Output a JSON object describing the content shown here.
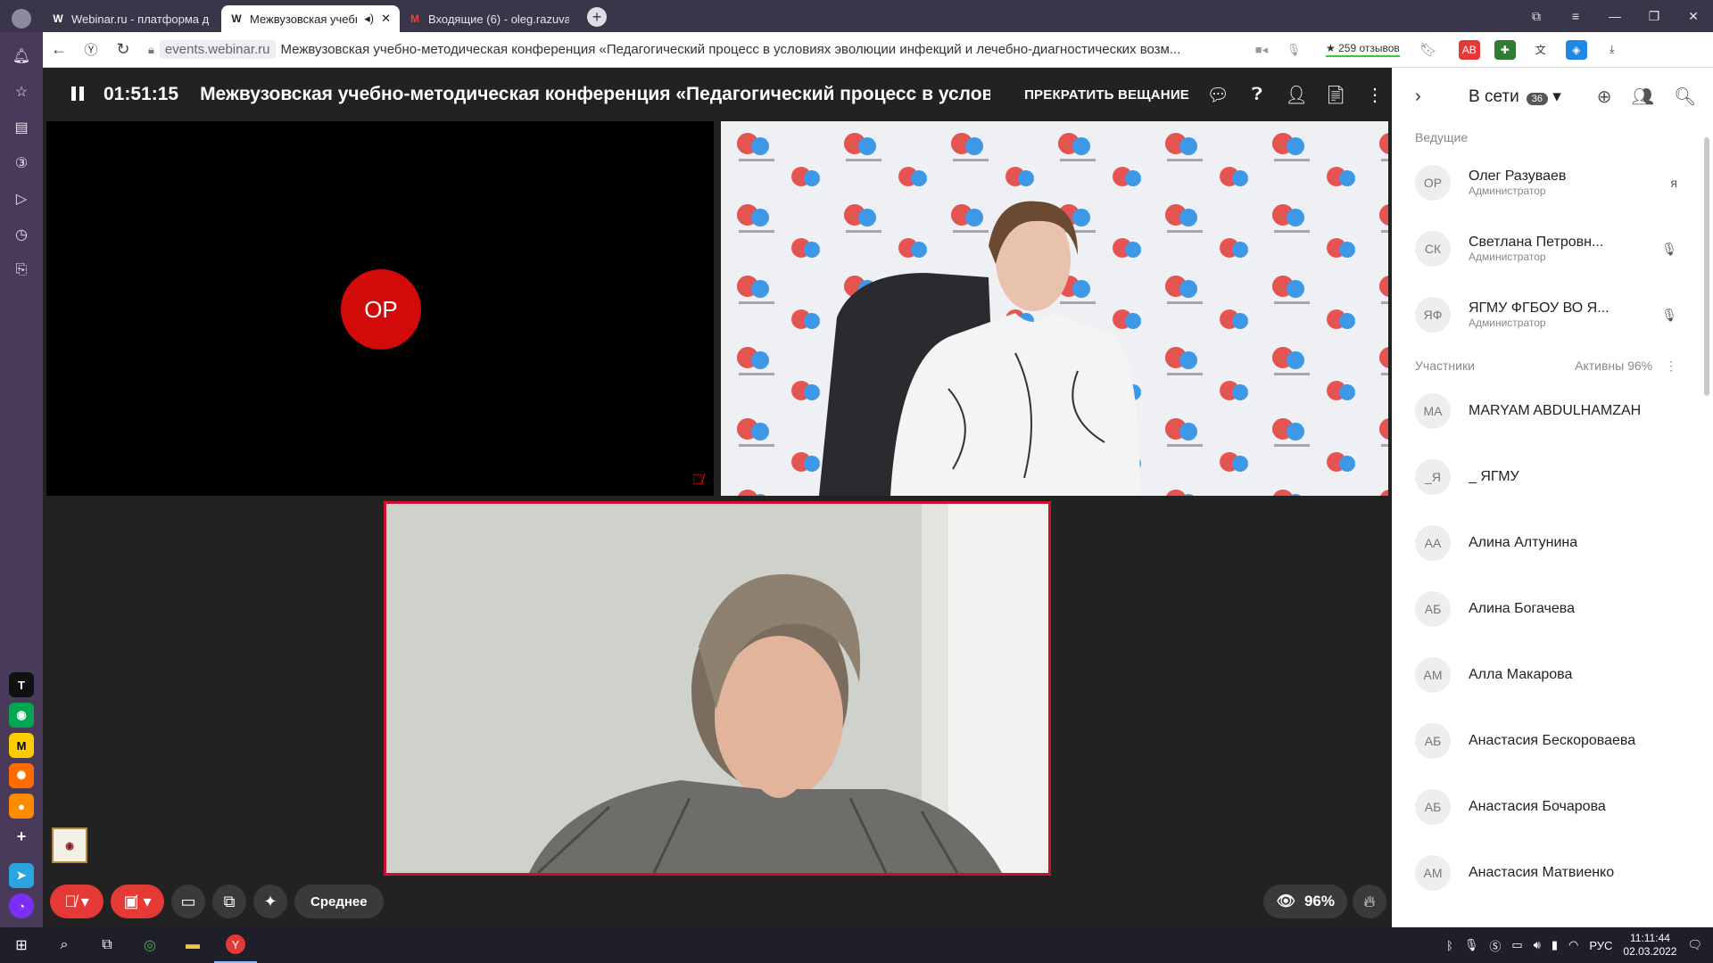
{
  "browser": {
    "tabs": [
      {
        "favicon": "W",
        "label": "Webinar.ru - платформа д"
      },
      {
        "favicon": "W",
        "label": "Межвузовская учебн",
        "active": true
      },
      {
        "favicon": "M",
        "label": "Входящие (6) - oleg.razuva"
      }
    ],
    "new_tab": "+",
    "address": {
      "domain": "events.webinar.ru",
      "page_title": "Межвузовская учебно-методическая конференция «Педагогический процесс в условиях эволюции инфекций и лечебно-диагностических возм..."
    },
    "reviews": "★ 259 отзывов"
  },
  "webinar": {
    "timer": "01:51:15",
    "title": "Межвузовская учебно-методическая конференция «Педагогический процесс в условиях эв",
    "stop_broadcast": "ПРЕКРАТИТЬ ВЕЩАНИЕ",
    "video1_initials": "ОР",
    "quality": "Среднее",
    "viewers_percent": "96%"
  },
  "panel": {
    "title": "В сети",
    "online_count": "36",
    "hosts_label": "Ведущие",
    "participants_label": "Участники",
    "active_label": "Активны 96%",
    "hosts": [
      {
        "initials": "ОР",
        "name": "Олег Разуваев",
        "role": "Администратор",
        "extra": "я"
      },
      {
        "initials": "СК",
        "name": "Светлана Петровн...",
        "role": "Администратор",
        "extra": "mic"
      },
      {
        "initials": "ЯФ",
        "name": "ЯГМУ ФГБОУ ВО Я...",
        "role": "Администратор",
        "extra": "mic"
      }
    ],
    "participants": [
      {
        "initials": "MA",
        "name": "MARYAM ABDULHAMZAH"
      },
      {
        "initials": "_Я",
        "name": "_ ЯГМУ"
      },
      {
        "initials": "АА",
        "name": "Алина Алтунина"
      },
      {
        "initials": "АБ",
        "name": "Алина Богачева"
      },
      {
        "initials": "АМ",
        "name": "Алла Макарова"
      },
      {
        "initials": "АБ",
        "name": "Анастасия Бескороваева"
      },
      {
        "initials": "АБ",
        "name": "Анастасия Бочарова"
      },
      {
        "initials": "АМ",
        "name": "Анастасия Матвиенко"
      }
    ]
  },
  "taskbar": {
    "lang": "РУС",
    "time": "11:11:44",
    "date": "02.03.2022"
  },
  "colors": {
    "accent_red": "#d20a0a",
    "browser_frame": "#3a3548"
  }
}
